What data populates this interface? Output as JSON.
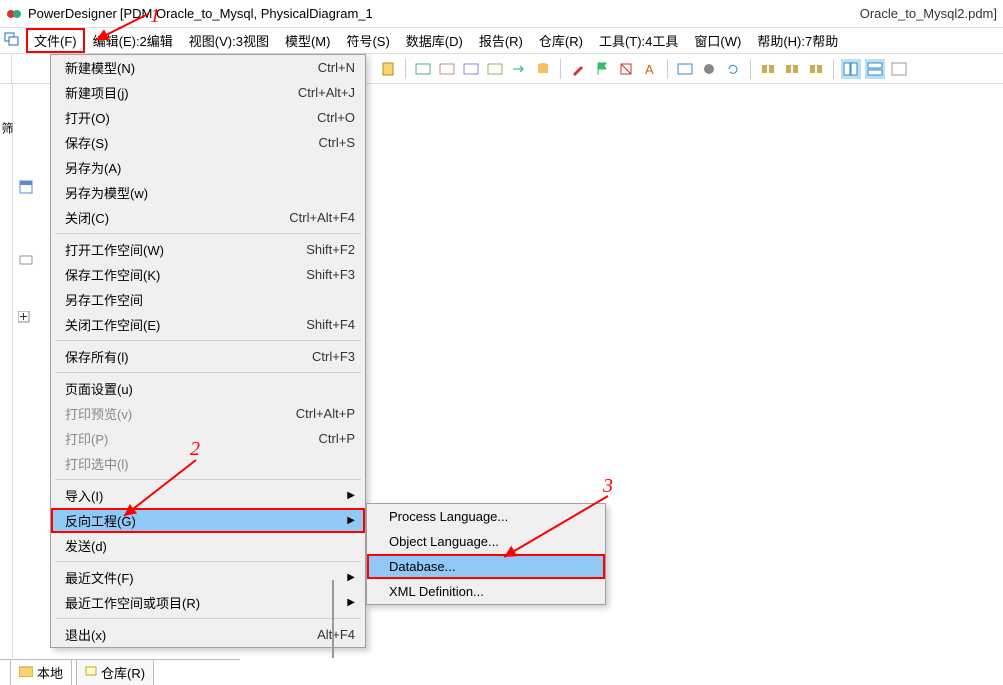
{
  "title": {
    "app": "PowerDesigner",
    "doc": "[PDM Oracle_to_Mysql, PhysicalDiagram_1",
    "tail": "Oracle_to_Mysql2.pdm]"
  },
  "annotations": {
    "n1": "1",
    "n2": "2",
    "n3": "3"
  },
  "menubar": {
    "file": "文件(F)",
    "edit": "编辑(E):2编辑",
    "view": "视图(V):3视图",
    "model": "模型(M)",
    "symbol": "符号(S)",
    "database": "数据库(D)",
    "report": "报告(R)",
    "repository": "仓库(R)",
    "tools": "工具(T):4工具",
    "window": "窗口(W)",
    "help": "帮助(H):7帮助"
  },
  "sidebar": {
    "tab_label": "筛"
  },
  "dropdown": {
    "new_model": {
      "label": "新建模型(N)",
      "shortcut": "Ctrl+N"
    },
    "new_project": {
      "label": "新建项目(j)",
      "shortcut": "Ctrl+Alt+J"
    },
    "open": {
      "label": "打开(O)",
      "shortcut": "Ctrl+O"
    },
    "save": {
      "label": "保存(S)",
      "shortcut": "Ctrl+S"
    },
    "save_as": {
      "label": "另存为(A)",
      "shortcut": ""
    },
    "save_as_model": {
      "label": "另存为模型(w)",
      "shortcut": ""
    },
    "close": {
      "label": "关闭(C)",
      "shortcut": "Ctrl+Alt+F4"
    },
    "open_workspace": {
      "label": "打开工作空间(W)",
      "shortcut": "Shift+F2"
    },
    "save_workspace": {
      "label": "保存工作空间(K)",
      "shortcut": "Shift+F3"
    },
    "save_workspace_as": {
      "label": "另存工作空间",
      "shortcut": ""
    },
    "close_workspace": {
      "label": "关闭工作空间(E)",
      "shortcut": "Shift+F4"
    },
    "save_all": {
      "label": "保存所有(l)",
      "shortcut": "Ctrl+F3"
    },
    "page_setup": {
      "label": "页面设置(u)",
      "shortcut": ""
    },
    "print_preview": {
      "label": "打印预览(v)",
      "shortcut": "Ctrl+Alt+P"
    },
    "print": {
      "label": "打印(P)",
      "shortcut": "Ctrl+P"
    },
    "print_selection": {
      "label": "打印选中(l)",
      "shortcut": ""
    },
    "import": {
      "label": "导入(I)",
      "shortcut": ""
    },
    "reverse_engineer": {
      "label": "反向工程(G)",
      "shortcut": ""
    },
    "send": {
      "label": "发送(d)",
      "shortcut": ""
    },
    "recent_files": {
      "label": "最近文件(F)",
      "shortcut": ""
    },
    "recent_workspaces": {
      "label": "最近工作空间或项目(R)",
      "shortcut": ""
    },
    "exit": {
      "label": "退出(x)",
      "shortcut": "Alt+F4"
    }
  },
  "submenu": {
    "process_language": "Process Language...",
    "object_language": "Object Language...",
    "database": "Database...",
    "xml_definition": "XML Definition..."
  },
  "bottom_tabs": {
    "local": "本地",
    "repository": "仓库(R)"
  }
}
